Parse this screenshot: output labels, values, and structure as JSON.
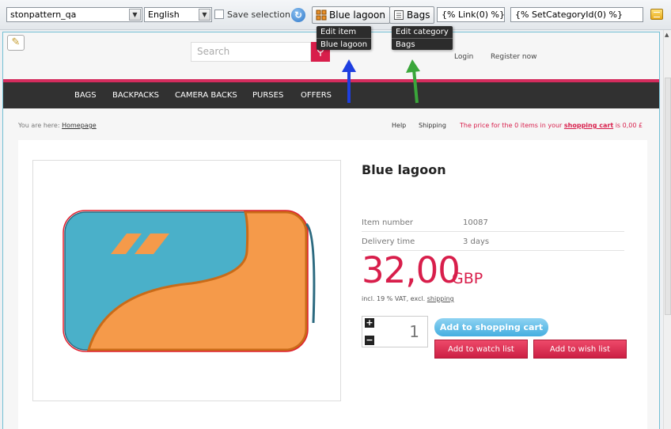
{
  "toolbar": {
    "shop_select": "stonpattern_qa",
    "language_select": "English",
    "save_selection_label": "Save selection",
    "item_button_label": "Blue lagoon",
    "category_button_label": "Bags",
    "link_field": "{% Link(0) %}",
    "category_field": "{% SetCategoryId(0) %}"
  },
  "item_menu": {
    "edit": "Edit item",
    "name": "Blue lagoon"
  },
  "category_menu": {
    "edit": "Edit category",
    "name": "Bags"
  },
  "header": {
    "search_placeholder": "Search",
    "login": "Login",
    "register": "Register now"
  },
  "nav": [
    "BAGS",
    "BACKPACKS",
    "CAMERA BACKS",
    "PURSES",
    "OFFERS"
  ],
  "breadcrumb": {
    "prefix": "You are here:",
    "home": "Homepage"
  },
  "topbar": {
    "help": "Help",
    "shipping": "Shipping",
    "cart_prefix": "The price for the 0 items in your",
    "cart_link": "shopping cart",
    "cart_suffix": "is 0,00 £"
  },
  "product": {
    "title": "Blue lagoon",
    "item_number_label": "Item number",
    "item_number": "10087",
    "delivery_label": "Delivery time",
    "delivery": "3 days",
    "price": "32,00",
    "currency": "GBP",
    "vat_prefix": "incl. 19 % VAT, excl.",
    "vat_link": "shipping",
    "quantity": "1",
    "add_to_cart": "Add to shopping cart",
    "watch_list": "Add to watch list",
    "wish_list": "Add to wish list"
  },
  "colors": {
    "accent": "#d81e4b",
    "nav_bg": "#313131",
    "cart_button": "#44aee0",
    "arrow_blue": "#1f3fe0",
    "arrow_green": "#3aa63a",
    "product_blue": "#4ab0c9",
    "product_orange": "#f59a4a"
  }
}
